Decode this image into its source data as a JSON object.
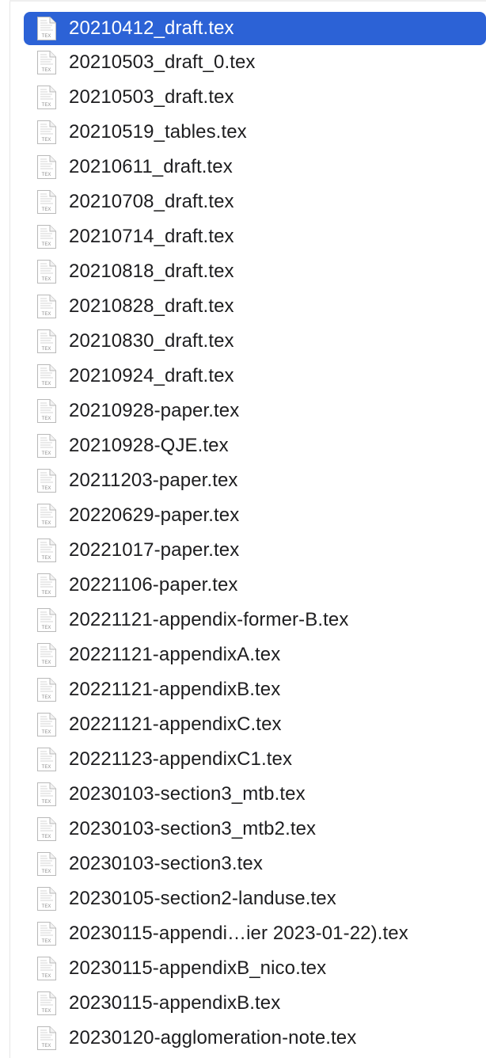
{
  "files": [
    {
      "name": "20210412_draft.tex",
      "selected": true,
      "icon": "tex-file-icon",
      "icon_label": "TEX"
    },
    {
      "name": "20210503_draft_0.tex",
      "selected": false,
      "icon": "tex-file-icon",
      "icon_label": "TEX"
    },
    {
      "name": "20210503_draft.tex",
      "selected": false,
      "icon": "tex-file-icon",
      "icon_label": "TEX"
    },
    {
      "name": "20210519_tables.tex",
      "selected": false,
      "icon": "tex-file-icon",
      "icon_label": "TEX"
    },
    {
      "name": "20210611_draft.tex",
      "selected": false,
      "icon": "tex-file-icon",
      "icon_label": "TEX"
    },
    {
      "name": "20210708_draft.tex",
      "selected": false,
      "icon": "tex-file-icon",
      "icon_label": "TEX"
    },
    {
      "name": "20210714_draft.tex",
      "selected": false,
      "icon": "tex-file-icon",
      "icon_label": "TEX"
    },
    {
      "name": "20210818_draft.tex",
      "selected": false,
      "icon": "tex-file-icon",
      "icon_label": "TEX"
    },
    {
      "name": "20210828_draft.tex",
      "selected": false,
      "icon": "tex-file-icon",
      "icon_label": "TEX"
    },
    {
      "name": "20210830_draft.tex",
      "selected": false,
      "icon": "tex-file-icon",
      "icon_label": "TEX"
    },
    {
      "name": "20210924_draft.tex",
      "selected": false,
      "icon": "tex-file-icon",
      "icon_label": "TEX"
    },
    {
      "name": "20210928-paper.tex",
      "selected": false,
      "icon": "tex-file-icon",
      "icon_label": "TEX"
    },
    {
      "name": "20210928-QJE.tex",
      "selected": false,
      "icon": "tex-file-icon",
      "icon_label": "TEX"
    },
    {
      "name": "20211203-paper.tex",
      "selected": false,
      "icon": "tex-file-icon",
      "icon_label": "TEX"
    },
    {
      "name": "20220629-paper.tex",
      "selected": false,
      "icon": "tex-file-icon",
      "icon_label": "TEX"
    },
    {
      "name": "20221017-paper.tex",
      "selected": false,
      "icon": "tex-file-icon",
      "icon_label": "TEX"
    },
    {
      "name": "20221106-paper.tex",
      "selected": false,
      "icon": "tex-file-icon",
      "icon_label": "TEX"
    },
    {
      "name": "20221121-appendix-former-B.tex",
      "selected": false,
      "icon": "tex-file-icon",
      "icon_label": "TEX"
    },
    {
      "name": "20221121-appendixA.tex",
      "selected": false,
      "icon": "tex-file-icon",
      "icon_label": "TEX"
    },
    {
      "name": "20221121-appendixB.tex",
      "selected": false,
      "icon": "tex-file-icon",
      "icon_label": "TEX"
    },
    {
      "name": "20221121-appendixC.tex",
      "selected": false,
      "icon": "tex-file-icon",
      "icon_label": "TEX"
    },
    {
      "name": "20221123-appendixC1.tex",
      "selected": false,
      "icon": "tex-file-icon",
      "icon_label": "TEX"
    },
    {
      "name": "20230103-section3_mtb.tex",
      "selected": false,
      "icon": "tex-file-icon",
      "icon_label": "TEX"
    },
    {
      "name": "20230103-section3_mtb2.tex",
      "selected": false,
      "icon": "tex-file-icon",
      "icon_label": "TEX"
    },
    {
      "name": "20230103-section3.tex",
      "selected": false,
      "icon": "tex-file-icon",
      "icon_label": "TEX"
    },
    {
      "name": "20230105-section2-landuse.tex",
      "selected": false,
      "icon": "tex-file-icon",
      "icon_label": "TEX"
    },
    {
      "name": "20230115-appendi…ier 2023-01-22).tex",
      "selected": false,
      "icon": "tex-file-icon",
      "icon_label": "TEX"
    },
    {
      "name": "20230115-appendixB_nico.tex",
      "selected": false,
      "icon": "tex-file-icon",
      "icon_label": "TEX"
    },
    {
      "name": "20230115-appendixB.tex",
      "selected": false,
      "icon": "tex-file-icon",
      "icon_label": "TEX"
    },
    {
      "name": "20230120-agglomeration-note.tex",
      "selected": false,
      "icon": "tex-file-icon",
      "icon_label": "TEX"
    }
  ],
  "colors": {
    "selection": "#2c62d6",
    "text": "#1d1d1f",
    "selected_text": "#ffffff"
  }
}
